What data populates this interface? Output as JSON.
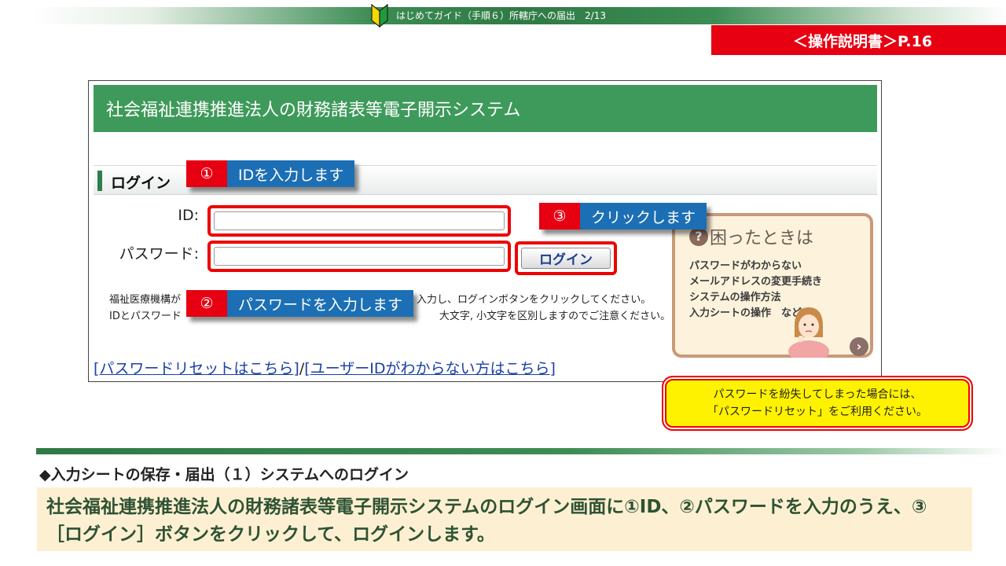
{
  "header": {
    "title": "はじめてガイド（手順６）所轄庁への届出　2/13",
    "manual_ref": "＜操作説明書＞P.16"
  },
  "screen": {
    "system_title": "社会福祉連携推進法人の財務諸表等電子開示システム",
    "login_heading": "ログイン",
    "id_label": "ID:",
    "password_label": "パスワード:",
    "login_button": "ログイン",
    "notice_line1_start": "福祉医療機構が",
    "notice_line1_end": "入力し、ログインボタンをクリックしてください。",
    "notice_line2_start": "IDとパスワード",
    "notice_line2_end": "大文字, 小文字を区別しますのでご注意ください。",
    "reset_link": "[パスワードリセットはこちら]",
    "separator": "/",
    "forgot_id_link": "[ユーザーIDがわからない方はこちら]"
  },
  "help_panel": {
    "title": "困ったときは",
    "items": [
      "パスワードがわからない",
      "メールアドレスの変更手続き",
      "システムの操作方法",
      "入力シートの操作　など・・"
    ]
  },
  "steps": [
    {
      "num": "①",
      "label": "IDを入力します"
    },
    {
      "num": "②",
      "label": "パスワードを入力します"
    },
    {
      "num": "③",
      "label": "クリックします"
    }
  ],
  "tip": {
    "line1": "パスワードを紛失してしまった場合には、",
    "line2": "「パスワードリセット」をご利用ください。"
  },
  "section": {
    "title": "◆入力シートの保存・届出（１）システムへのログイン",
    "description": "社会福祉連携推進法人の財務諸表等電子開示システムのログイン画面に①ID、②パスワードを入力のうえ、③［ログイン］ボタンをクリックして、ログインします。"
  },
  "colors": {
    "accent_green": "#3e9a5a",
    "alert_red": "#e60012",
    "step_blue": "#1c6fb4",
    "tip_yellow": "#fff200"
  },
  "icons": [
    "beginner-mark-icon",
    "question-icon",
    "chevron-right-icon"
  ]
}
